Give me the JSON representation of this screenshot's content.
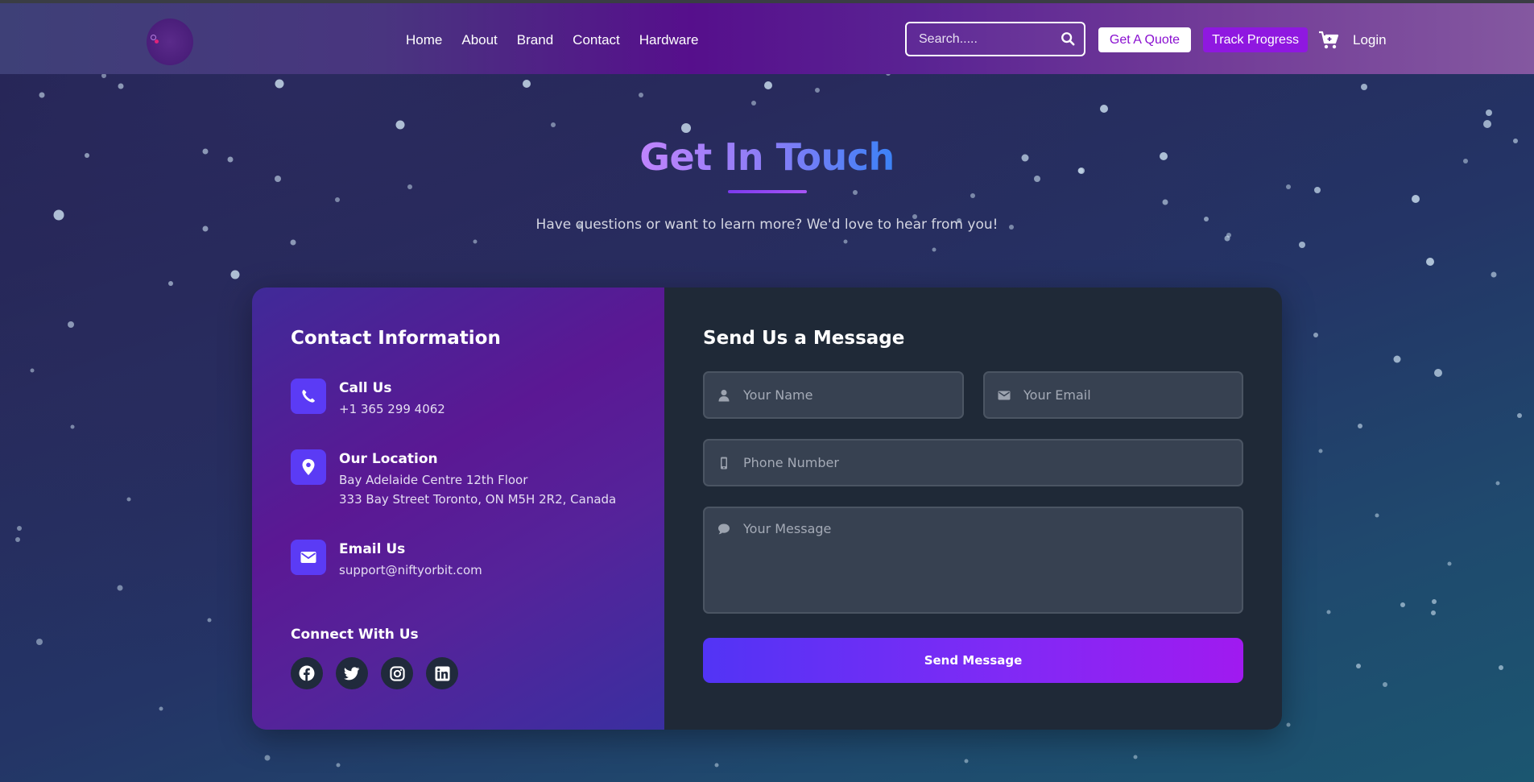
{
  "nav": {
    "links": [
      "Home",
      "About",
      "Brand",
      "Contact",
      "Hardware"
    ],
    "search_placeholder": "Search.....",
    "quote_label": "Get A Quote",
    "track_label": "Track Progress",
    "login_label": "Login"
  },
  "hero": {
    "title": "Get In Touch",
    "subtitle": "Have questions or want to learn more? We'd love to hear from you!"
  },
  "contact_info": {
    "heading": "Contact Information",
    "call": {
      "title": "Call Us",
      "lines": [
        "+1 365 299 4062"
      ],
      "icon": "phone-icon"
    },
    "location": {
      "title": "Our Location",
      "lines": [
        "Bay Adelaide Centre 12th Floor",
        "333 Bay Street Toronto, ON M5H 2R2, Canada"
      ],
      "icon": "map-pin-icon"
    },
    "email": {
      "title": "Email Us",
      "lines": [
        "support@niftyorbit.com"
      ],
      "icon": "envelope-icon"
    },
    "connect_heading": "Connect With Us",
    "socials": [
      "facebook-icon",
      "twitter-icon",
      "instagram-icon",
      "linkedin-icon"
    ]
  },
  "form": {
    "heading": "Send Us a Message",
    "name_placeholder": "Your Name",
    "email_placeholder": "Your Email",
    "phone_placeholder": "Phone Number",
    "message_placeholder": "Your Message",
    "submit_label": "Send Message"
  },
  "colors": {
    "accent": "#5b3bf5",
    "track_button": "#8f18e0",
    "form_panel": "#1f2937",
    "field_bg": "#374151"
  }
}
